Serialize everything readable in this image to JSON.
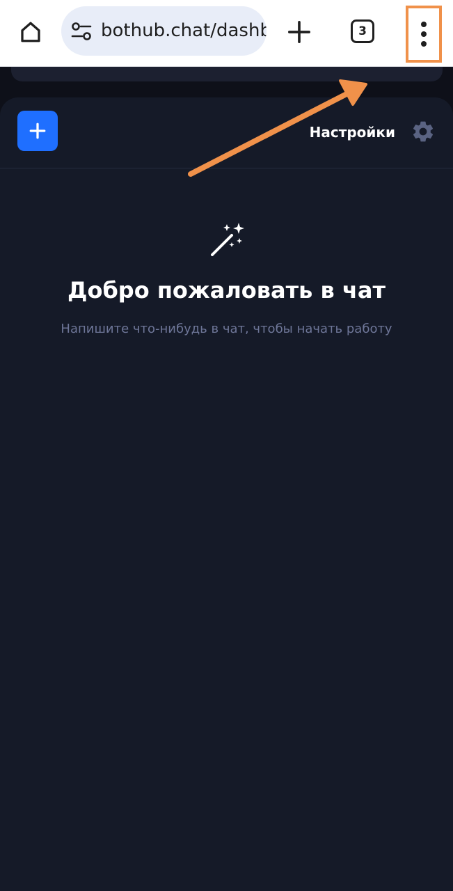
{
  "browser": {
    "url": "bothub.chat/dashboard",
    "tab_count": "3",
    "icons": {
      "home": "home-icon",
      "site_settings": "tune-icon",
      "new_tab": "plus-icon",
      "tabs": "tab-switcher-icon",
      "menu": "more-vert-icon"
    },
    "highlight_color": "#f0914a"
  },
  "panel": {
    "new_chat_icon": "plus-icon",
    "settings_label": "Настройки",
    "settings_icon": "gear-icon"
  },
  "welcome": {
    "icon": "magic-wand-icon",
    "title": "Добро пожаловать в чат",
    "subtitle": "Напишите что-нибудь в чат, чтобы начать работу"
  },
  "colors": {
    "page_background": "#0e1019",
    "panel_background": "#151a28",
    "accent_blue": "#1f6fff",
    "subtitle_text": "#6e7698",
    "annotation": "#f0914a"
  }
}
